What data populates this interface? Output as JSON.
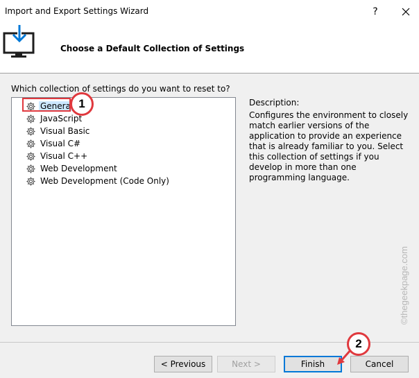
{
  "window": {
    "title": "Import and Export Settings Wizard",
    "help_label": "?",
    "close_icon": "close-icon"
  },
  "header": {
    "title": "Choose a Default Collection of Settings",
    "icon": "monitor-download-icon"
  },
  "question": "Which collection of settings do you want to reset to?",
  "collections": [
    {
      "label": "General",
      "selected": true
    },
    {
      "label": "JavaScript",
      "selected": false
    },
    {
      "label": "Visual Basic",
      "selected": false
    },
    {
      "label": "Visual C#",
      "selected": false
    },
    {
      "label": "Visual C++",
      "selected": false
    },
    {
      "label": "Web Development",
      "selected": false
    },
    {
      "label": "Web Development (Code Only)",
      "selected": false
    }
  ],
  "description": {
    "label": "Description:",
    "text": "Configures the environment to closely match earlier versions of the application to provide an experience that is already familiar to you. Select this collection of settings if you develop in more than one programming language."
  },
  "buttons": {
    "previous": "< Previous",
    "next": "Next >",
    "finish": "Finish",
    "cancel": "Cancel"
  },
  "annotations": {
    "badge_1": "1",
    "badge_2": "2",
    "color": "#e0393e"
  },
  "watermark": "©thegeekpage.com"
}
